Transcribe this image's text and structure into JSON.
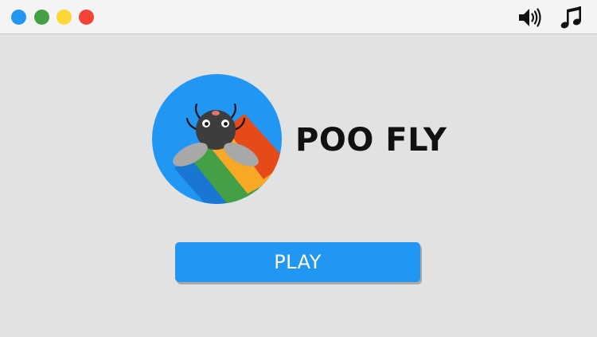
{
  "window": {
    "controls": [
      {
        "name": "blue",
        "color": "#2196f3"
      },
      {
        "name": "green",
        "color": "#43a047"
      },
      {
        "name": "yellow",
        "color": "#fdd835"
      },
      {
        "name": "red",
        "color": "#f44336"
      }
    ],
    "icons": {
      "sound": "speaker-icon",
      "music": "music-note-icon"
    }
  },
  "game": {
    "title": "POO FLY",
    "play_label": "PLAY",
    "logo_icon": "fly-logo-icon"
  },
  "colors": {
    "accent": "#2196f3",
    "background": "#e2e2e2",
    "titlebar": "#f4f4f4",
    "stripe_blue": "#1976d2",
    "stripe_green": "#43a047",
    "stripe_yellow": "#f9a825",
    "stripe_red": "#e64a19",
    "fly_body": "#3d3d3d",
    "fly_wing": "#a8a8a8"
  }
}
